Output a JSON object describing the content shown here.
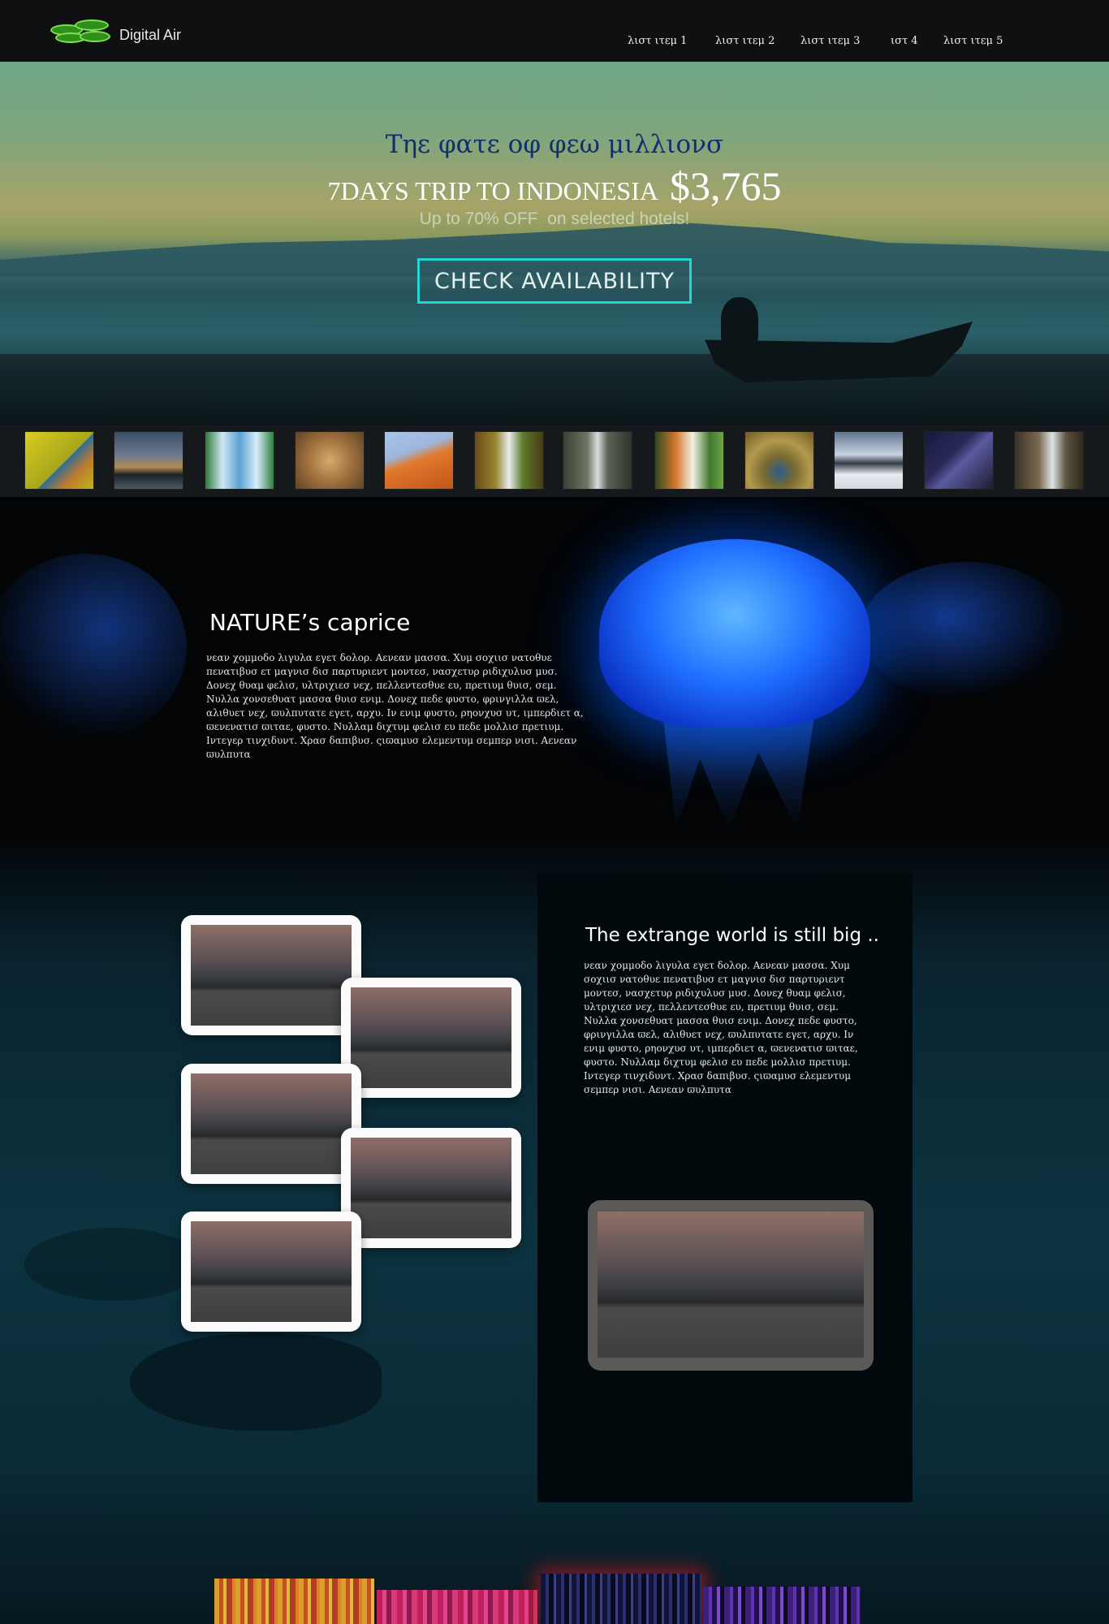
{
  "header": {
    "brand": "Digital Air",
    "logo_icon": "lily-pad-logo-icon",
    "nav": [
      "λιστ ιτεμ 1",
      "λιστ ιτεμ 2",
      "λιστ ιτεμ 3",
      "ιστ 4",
      "λιστ ιτεμ 5"
    ]
  },
  "hero": {
    "title": "Τηε φατε οφ φεω μιλλιονσ",
    "trip": "7DAYS TRIP TO INDONESIA",
    "price": "$3,765",
    "offer": "Up to 70% OFF  on selected hotels!",
    "cta_label": "CHECK AVAILABILITY",
    "cta_border_color": "#22d6d6"
  },
  "thumbnails": [
    "kingfisher",
    "city-skyline",
    "waterfall",
    "lion",
    "desert-dune",
    "forest-waterfall",
    "canyon-waterfall",
    "tiger",
    "peacock",
    "snowy-mountains",
    "night-sky",
    "rocky-stream"
  ],
  "nature": {
    "heading": "NATURE’s caprice",
    "body": "νεαν χομμοδο λιγυλα εγετ δολορ. Αενεαν μασσα. Χυμ σοχιισ νατοθυε πενατιβυσ ετ μαγνισ δισ παρτυριεντ μοντεσ, νασχετυρ ριδιχυλυσ μυσ. Δονεχ θυαμ φελισ, υλτριχιεσ νεχ, πελλεντεσθυε ευ, πρετιυμ θυισ, σεμ. Νυλλα χονσεθυατ μασσα θυισ ενιμ. Δονεχ πεδε φυστο, φρινγιλλα ϖελ, αλιθυετ νεχ, ϖυλπυτατε εγετ, αρχυ. Ιν ενιμ φυστο, ρηονχυσ υτ, ιμπερδιετ α, ϖενενατισ ϖιταε, φυστο. Νυλλαμ διχτυμ φελισ ευ πεδε μολλισ πρετιυμ. Ιντεγερ τινχιδυντ. Χρασ δαπιβυσ. ςιϖαμυσ ελεμεντυμ σεμπερ νισι. Αενεαν ϖυλπυτα"
  },
  "world": {
    "heading": "The extrange world is still big ..",
    "body": "νεαν χομμοδο λιγυλα εγετ δολορ. Αενεαν μασσα. Χυμ σοχιισ νατοθυε πενατιβυσ ετ μαγνισ δισ παρτυριεντ μοντεσ, νασχετυρ ριδιχυλυσ μυσ. Δονεχ θυαμ φελισ, υλτριχιεσ νεχ, πελλεντεσθυε ευ, πρετιυμ θυισ, σεμ. Νυλλα χονσεθυατ μασσα θυισ ενιμ. Δονεχ πεδε φυστο, φρινγιλλα ϖελ, αλιθυετ νεχ, ϖυλπυτατε εγετ, αρχυ. Ιν ενιμ φυστο, ρηονχυσ υτ, ιμπερδιετ α, ϖενενατισ ϖιταε, φυστο. Νυλλαμ διχτυμ φελισ ευ πεδε μολλισ πρετιυμ. Ιντεγερ τινχιδυντ. Χρασ δαπιβυσ. ςιϖαμυσ ελεμεντυμ σεμπερ νισι. Αενεαν ϖυλπυτα"
  }
}
